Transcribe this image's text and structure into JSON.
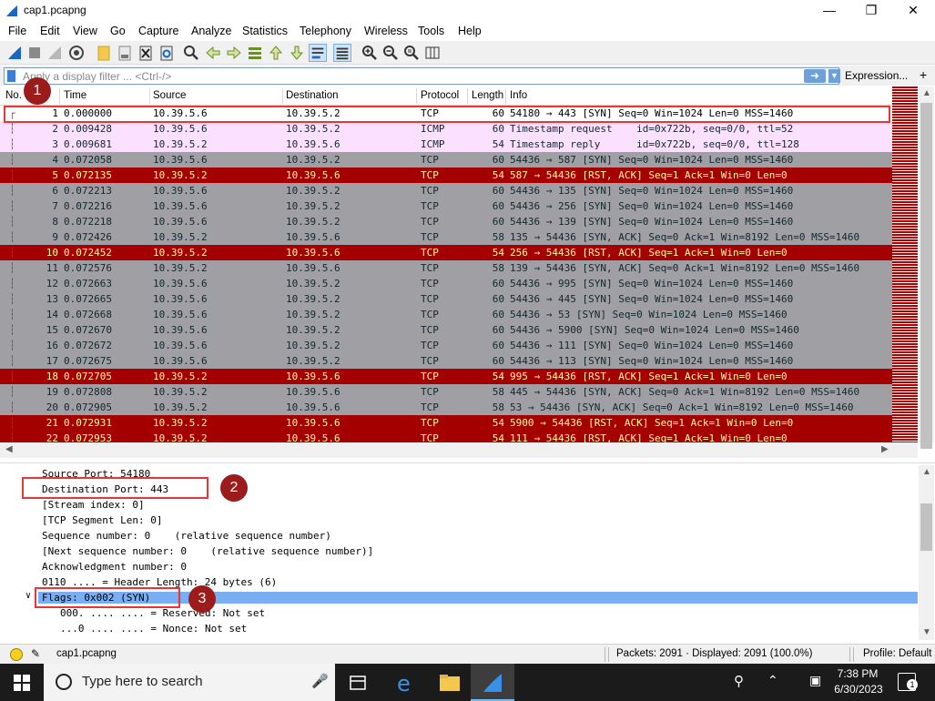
{
  "window": {
    "title": "cap1.pcapng"
  },
  "menu": [
    "File",
    "Edit",
    "View",
    "Go",
    "Capture",
    "Analyze",
    "Statistics",
    "Telephony",
    "Wireless",
    "Tools",
    "Help"
  ],
  "filter": {
    "placeholder": "Apply a display filter ... <Ctrl-/>",
    "expression_label": "Expression...",
    "add_label": "+"
  },
  "columns": [
    "No.",
    "Time",
    "Source",
    "Destination",
    "Protocol",
    "Length",
    "Info"
  ],
  "packets": [
    {
      "no": "1",
      "time": "0.000000",
      "src": "10.39.5.6",
      "dst": "10.39.5.2",
      "proto": "TCP",
      "len": "60",
      "info": "54180 → 443 [SYN] Seq=0 Win=1024 Len=0 MSS=1460",
      "style": "first"
    },
    {
      "no": "2",
      "time": "0.009428",
      "src": "10.39.5.6",
      "dst": "10.39.5.2",
      "proto": "ICMP",
      "len": "60",
      "info": "Timestamp request    id=0x722b, seq=0/0, ttl=52",
      "style": "icmp"
    },
    {
      "no": "3",
      "time": "0.009681",
      "src": "10.39.5.2",
      "dst": "10.39.5.6",
      "proto": "ICMP",
      "len": "54",
      "info": "Timestamp reply      id=0x722b, seq=0/0, ttl=128",
      "style": "icmp"
    },
    {
      "no": "4",
      "time": "0.072058",
      "src": "10.39.5.6",
      "dst": "10.39.5.2",
      "proto": "TCP",
      "len": "60",
      "info": "54436 → 587 [SYN] Seq=0 Win=1024 Len=0 MSS=1460",
      "style": "tcp-gray"
    },
    {
      "no": "5",
      "time": "0.072135",
      "src": "10.39.5.2",
      "dst": "10.39.5.6",
      "proto": "TCP",
      "len": "54",
      "info": "587 → 54436 [RST, ACK] Seq=1 Ack=1 Win=0 Len=0",
      "style": "tcp-red"
    },
    {
      "no": "6",
      "time": "0.072213",
      "src": "10.39.5.6",
      "dst": "10.39.5.2",
      "proto": "TCP",
      "len": "60",
      "info": "54436 → 135 [SYN] Seq=0 Win=1024 Len=0 MSS=1460",
      "style": "tcp-gray"
    },
    {
      "no": "7",
      "time": "0.072216",
      "src": "10.39.5.6",
      "dst": "10.39.5.2",
      "proto": "TCP",
      "len": "60",
      "info": "54436 → 256 [SYN] Seq=0 Win=1024 Len=0 MSS=1460",
      "style": "tcp-gray"
    },
    {
      "no": "8",
      "time": "0.072218",
      "src": "10.39.5.6",
      "dst": "10.39.5.2",
      "proto": "TCP",
      "len": "60",
      "info": "54436 → 139 [SYN] Seq=0 Win=1024 Len=0 MSS=1460",
      "style": "tcp-gray"
    },
    {
      "no": "9",
      "time": "0.072426",
      "src": "10.39.5.2",
      "dst": "10.39.5.6",
      "proto": "TCP",
      "len": "58",
      "info": "135 → 54436 [SYN, ACK] Seq=0 Ack=1 Win=8192 Len=0 MSS=1460",
      "style": "tcp-gray"
    },
    {
      "no": "10",
      "time": "0.072452",
      "src": "10.39.5.2",
      "dst": "10.39.5.6",
      "proto": "TCP",
      "len": "54",
      "info": "256 → 54436 [RST, ACK] Seq=1 Ack=1 Win=0 Len=0",
      "style": "tcp-red"
    },
    {
      "no": "11",
      "time": "0.072576",
      "src": "10.39.5.2",
      "dst": "10.39.5.6",
      "proto": "TCP",
      "len": "58",
      "info": "139 → 54436 [SYN, ACK] Seq=0 Ack=1 Win=8192 Len=0 MSS=1460",
      "style": "tcp-gray"
    },
    {
      "no": "12",
      "time": "0.072663",
      "src": "10.39.5.6",
      "dst": "10.39.5.2",
      "proto": "TCP",
      "len": "60",
      "info": "54436 → 995 [SYN] Seq=0 Win=1024 Len=0 MSS=1460",
      "style": "tcp-gray"
    },
    {
      "no": "13",
      "time": "0.072665",
      "src": "10.39.5.6",
      "dst": "10.39.5.2",
      "proto": "TCP",
      "len": "60",
      "info": "54436 → 445 [SYN] Seq=0 Win=1024 Len=0 MSS=1460",
      "style": "tcp-gray"
    },
    {
      "no": "14",
      "time": "0.072668",
      "src": "10.39.5.6",
      "dst": "10.39.5.2",
      "proto": "TCP",
      "len": "60",
      "info": "54436 → 53 [SYN] Seq=0 Win=1024 Len=0 MSS=1460",
      "style": "tcp-gray"
    },
    {
      "no": "15",
      "time": "0.072670",
      "src": "10.39.5.6",
      "dst": "10.39.5.2",
      "proto": "TCP",
      "len": "60",
      "info": "54436 → 5900 [SYN] Seq=0 Win=1024 Len=0 MSS=1460",
      "style": "tcp-gray"
    },
    {
      "no": "16",
      "time": "0.072672",
      "src": "10.39.5.6",
      "dst": "10.39.5.2",
      "proto": "TCP",
      "len": "60",
      "info": "54436 → 111 [SYN] Seq=0 Win=1024 Len=0 MSS=1460",
      "style": "tcp-gray"
    },
    {
      "no": "17",
      "time": "0.072675",
      "src": "10.39.5.6",
      "dst": "10.39.5.2",
      "proto": "TCP",
      "len": "60",
      "info": "54436 → 113 [SYN] Seq=0 Win=1024 Len=0 MSS=1460",
      "style": "tcp-gray"
    },
    {
      "no": "18",
      "time": "0.072705",
      "src": "10.39.5.2",
      "dst": "10.39.5.6",
      "proto": "TCP",
      "len": "54",
      "info": "995 → 54436 [RST, ACK] Seq=1 Ack=1 Win=0 Len=0",
      "style": "tcp-red"
    },
    {
      "no": "19",
      "time": "0.072808",
      "src": "10.39.5.2",
      "dst": "10.39.5.6",
      "proto": "TCP",
      "len": "58",
      "info": "445 → 54436 [SYN, ACK] Seq=0 Ack=1 Win=8192 Len=0 MSS=1460",
      "style": "tcp-gray"
    },
    {
      "no": "20",
      "time": "0.072905",
      "src": "10.39.5.2",
      "dst": "10.39.5.6",
      "proto": "TCP",
      "len": "58",
      "info": "53 → 54436 [SYN, ACK] Seq=0 Ack=1 Win=8192 Len=0 MSS=1460",
      "style": "tcp-gray"
    },
    {
      "no": "21",
      "time": "0.072931",
      "src": "10.39.5.2",
      "dst": "10.39.5.6",
      "proto": "TCP",
      "len": "54",
      "info": "5900 → 54436 [RST, ACK] Seq=1 Ack=1 Win=0 Len=0",
      "style": "tcp-red"
    },
    {
      "no": "22",
      "time": "0.072953",
      "src": "10.39.5.2",
      "dst": "10.39.5.6",
      "proto": "TCP",
      "len": "54",
      "info": "111 → 54436 [RST, ACK] Seq=1 Ack=1 Win=0 Len=0",
      "style": "tcp-red"
    }
  ],
  "details": [
    "Source Port: 54180",
    "Destination Port: 443",
    "[Stream index: 0]",
    "[TCP Segment Len: 0]",
    "Sequence number: 0    (relative sequence number)",
    "[Next sequence number: 0    (relative sequence number)]",
    "Acknowledgment number: 0",
    "0110 .... = Header Length: 24 bytes (6)",
    "Flags: 0x002 (SYN)",
    "000. .... .... = Reserved: Not set",
    "...0 .... .... = Nonce: Not set"
  ],
  "annotations": [
    "1",
    "2",
    "3"
  ],
  "status": {
    "file": "cap1.pcapng",
    "packets": "Packets: 2091 · Displayed: 2091 (100.0%)",
    "profile": "Profile: Default"
  },
  "taskbar": {
    "search_placeholder": "Type here to search",
    "time": "7:38 PM",
    "date": "6/30/2023",
    "notifications": "1"
  },
  "colors": {
    "tcp_gray": "#a0a0a4",
    "tcp_red": "#a40000",
    "icmp": "#fce0ff",
    "selection": "#7aaef2",
    "annotation": "#e33333"
  }
}
